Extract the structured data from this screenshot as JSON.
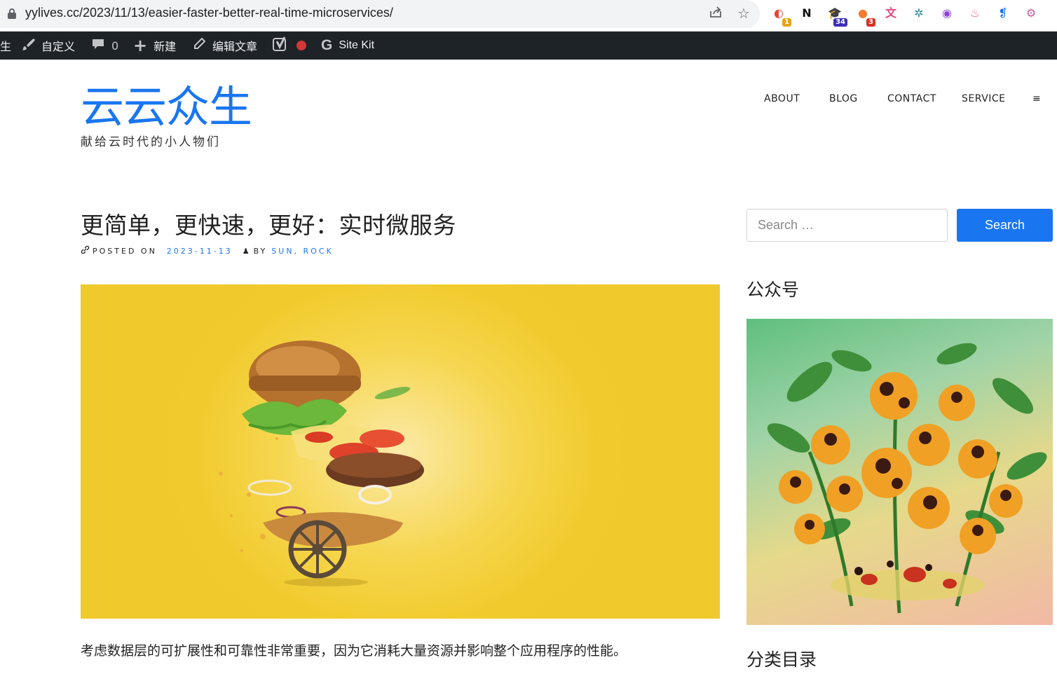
{
  "browser": {
    "url": "yylives.cc/2023/11/13/easier-faster-better-real-time-microservices/",
    "share_icon": "share-icon",
    "bookmark_icon": "star-icon",
    "extensions": [
      {
        "name": "extension-icon",
        "glyph": "◐",
        "color": "#ea4335",
        "badge": "1",
        "badge_color": "#e8a317"
      },
      {
        "name": "notion-icon",
        "glyph": "N",
        "color": "#111111",
        "badge": "",
        "badge_color": ""
      },
      {
        "name": "graduation-cap-icon",
        "glyph": "🎓",
        "color": "#3b2fb8",
        "badge": "34",
        "badge_color": "#3b2fb8"
      },
      {
        "name": "extension-icon",
        "glyph": "●",
        "color": "#f47b30",
        "badge": "3",
        "badge_color": "#d93025"
      },
      {
        "name": "translate-icon",
        "glyph": "文",
        "color": "#e0457b",
        "badge": "",
        "badge_color": ""
      },
      {
        "name": "extension-icon",
        "glyph": "✲",
        "color": "#2a8a9a",
        "badge": "",
        "badge_color": ""
      },
      {
        "name": "extension-icon",
        "glyph": "◉",
        "color": "#8e44d6",
        "badge": "",
        "badge_color": ""
      },
      {
        "name": "extension-icon",
        "glyph": "♨",
        "color": "#e06a8e",
        "badge": "",
        "badge_color": ""
      },
      {
        "name": "extension-icon",
        "glyph": "❡",
        "color": "#1a73e8",
        "badge": "",
        "badge_color": ""
      },
      {
        "name": "openai-icon",
        "glyph": "⚙",
        "color": "#c45ca0",
        "badge": "",
        "badge_color": ""
      }
    ]
  },
  "adminbar": {
    "site_fragment": "生",
    "customize": "自定义",
    "comments_count": "0",
    "new": "新建",
    "edit_post": "编辑文章",
    "yoast_icon": "yoast-icon",
    "status_color": "#d63638",
    "sitekit": "Site Kit"
  },
  "header": {
    "site_title": "云云众生",
    "tagline": "献给云时代的小人物们",
    "nav": [
      "ABOUT",
      "BLOG",
      "CONTACT",
      "SERVICE"
    ],
    "menu_toggle": "≡"
  },
  "post": {
    "title": "更简单，更快速，更好：实时微服务",
    "posted_on_label": "POSTED ON",
    "date": "2023-11-13",
    "by_label": "BY",
    "author": "SUN, ROCK",
    "excerpt": "考虑数据层的可扩展性和可靠性非常重要，因为它消耗大量资源并影响整个应用程序的性能。"
  },
  "sidebar": {
    "search_placeholder": "Search …",
    "search_button": "Search",
    "widget_wechat": "公众号",
    "widget_categories": "分类目录"
  },
  "colors": {
    "accent": "#1976f0",
    "adminbar_bg": "#1d2327",
    "hero_bg": "#f0c92c"
  }
}
